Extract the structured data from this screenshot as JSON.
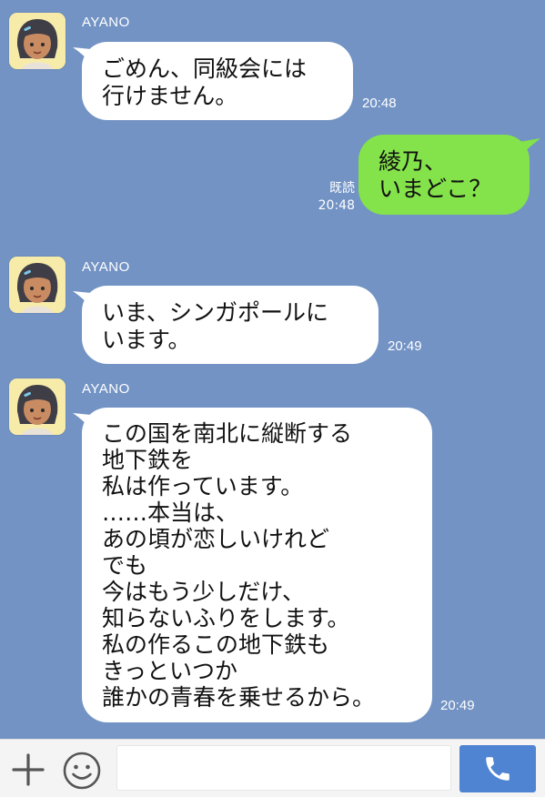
{
  "messages": [
    {
      "sender": "AYANO",
      "text": "ごめん、同級会には\n行けません。",
      "time": "20:48"
    },
    {
      "text": "綾乃、\nいまどこ？",
      "read": "既読",
      "time": "20:48"
    },
    {
      "sender": "AYANO",
      "text": "いま、シンガポールに\nいます。",
      "time": "20:49"
    },
    {
      "sender": "AYANO",
      "text": "この国を南北に縦断する\n地下鉄を\n私は作っています。\n……本当は、\nあの頃が恋しいけれど\nでも\n今はもう少しだけ、\n知らないふりをします。\n私の作るこの地下鉄も\nきっといつか\n誰かの青春を乗せるから。",
      "time": "20:49"
    }
  ],
  "input": {
    "placeholder": ""
  },
  "icons": {
    "add": "plus-icon",
    "emoji": "smiley-icon",
    "call": "phone-icon",
    "avatar": "avatar-girl-icon"
  },
  "colors": {
    "background": "#7293c4",
    "sent_bubble": "#84e24b",
    "received_bubble": "#ffffff",
    "call_button": "#4f84d2"
  }
}
